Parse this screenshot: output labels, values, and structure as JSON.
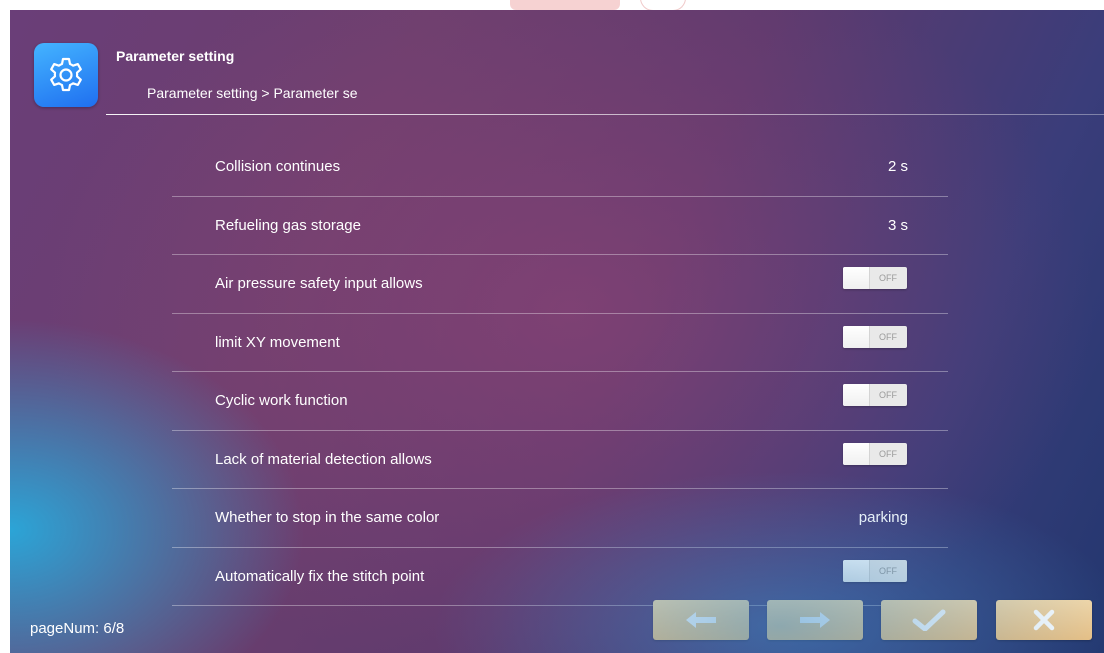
{
  "header": {
    "title": "Parameter setting",
    "breadcrumb": "Parameter setting > Parameter se"
  },
  "rows": [
    {
      "label": "Collision continues",
      "value": "2 s"
    },
    {
      "label": "Refueling gas storage",
      "value": "3 s"
    },
    {
      "label": "Air pressure safety input allows",
      "toggle": "OFF"
    },
    {
      "label": "limit XY movement",
      "toggle": "OFF"
    },
    {
      "label": "Cyclic work function",
      "toggle": "OFF"
    },
    {
      "label": "Lack of material detection allows",
      "toggle": "OFF"
    },
    {
      "label": "Whether to stop in the same color",
      "value": "parking"
    },
    {
      "label": "Automatically fix the stitch point",
      "toggle": "OFF"
    }
  ],
  "footer": {
    "page_num": "pageNum: 6/8"
  },
  "icons": {
    "app": "gear-icon",
    "prev": "arrow-left-icon",
    "next": "arrow-right-icon",
    "confirm": "check-icon",
    "close": "close-icon"
  },
  "colors": {
    "button": "#f1c98c",
    "app_icon": "#2a86f5",
    "toggle_off": "#e9e9e9"
  }
}
